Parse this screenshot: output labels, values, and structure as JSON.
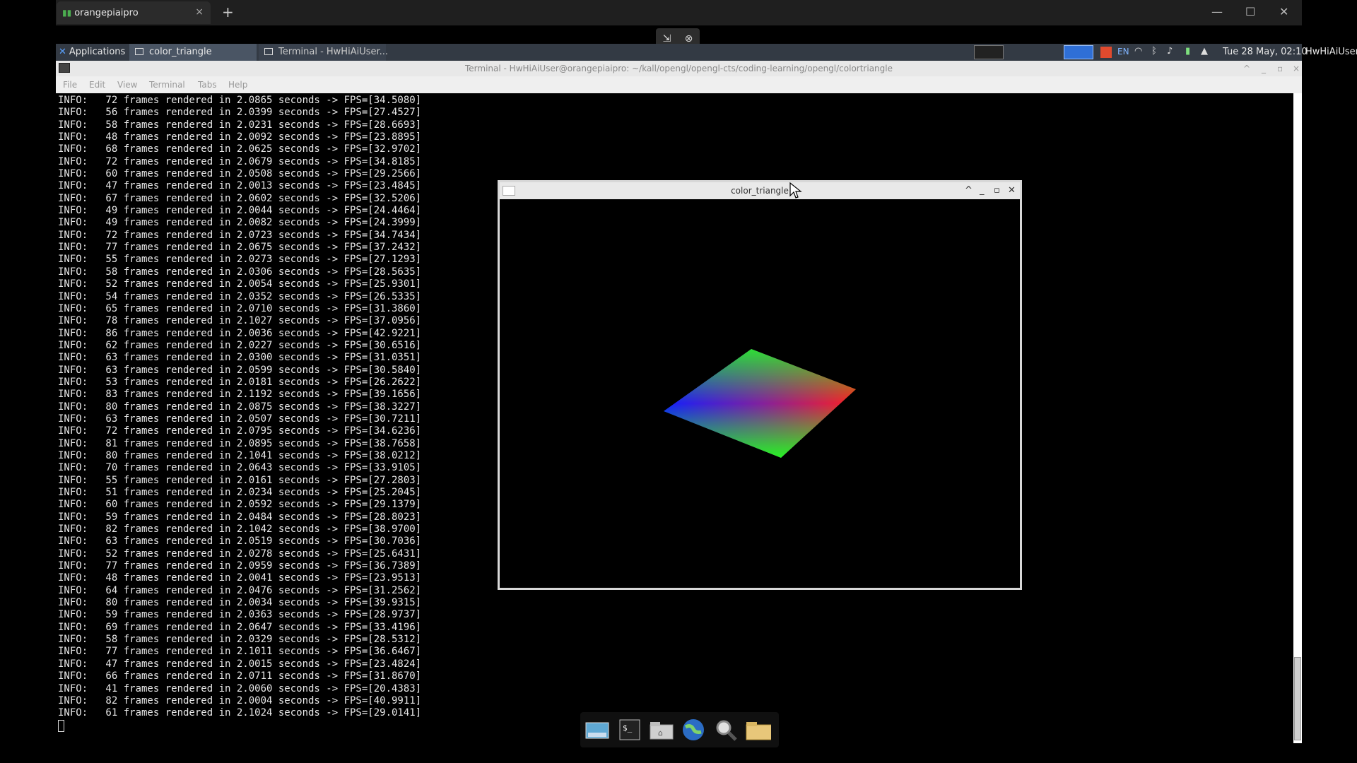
{
  "host": {
    "tab_label": "orangepiaipro",
    "tab_close": "×",
    "new_tab": "+",
    "minimize": "—",
    "maximize": "☐",
    "close": "✕"
  },
  "panel": {
    "applications": "Applications",
    "tasks": [
      {
        "label": "color_triangle"
      },
      {
        "label": "Terminal - HwHiAiUser..."
      }
    ],
    "lang": "EN",
    "clock": "Tue 28 May, 02:10",
    "user": "HwHiAiUser"
  },
  "terminal": {
    "title": "Terminal - HwHiAiUser@orangepiaipro: ~/kall/opengl/opengl-cts/coding-learning/opengl/colortriangle",
    "menu": [
      "File",
      "Edit",
      "View",
      "Terminal",
      "Tabs",
      "Help"
    ],
    "log_lines": [
      "INFO:   72 frames rendered in 2.0865 seconds -> FPS=[34.5080]",
      "INFO:   56 frames rendered in 2.0399 seconds -> FPS=[27.4527]",
      "INFO:   58 frames rendered in 2.0231 seconds -> FPS=[28.6693]",
      "INFO:   48 frames rendered in 2.0092 seconds -> FPS=[23.8895]",
      "INFO:   68 frames rendered in 2.0625 seconds -> FPS=[32.9702]",
      "INFO:   72 frames rendered in 2.0679 seconds -> FPS=[34.8185]",
      "INFO:   60 frames rendered in 2.0508 seconds -> FPS=[29.2566]",
      "INFO:   47 frames rendered in 2.0013 seconds -> FPS=[23.4845]",
      "INFO:   67 frames rendered in 2.0602 seconds -> FPS=[32.5206]",
      "INFO:   49 frames rendered in 2.0044 seconds -> FPS=[24.4464]",
      "INFO:   49 frames rendered in 2.0082 seconds -> FPS=[24.3999]",
      "INFO:   72 frames rendered in 2.0723 seconds -> FPS=[34.7434]",
      "INFO:   77 frames rendered in 2.0675 seconds -> FPS=[37.2432]",
      "INFO:   55 frames rendered in 2.0273 seconds -> FPS=[27.1293]",
      "INFO:   58 frames rendered in 2.0306 seconds -> FPS=[28.5635]",
      "INFO:   52 frames rendered in 2.0054 seconds -> FPS=[25.9301]",
      "INFO:   54 frames rendered in 2.0352 seconds -> FPS=[26.5335]",
      "INFO:   65 frames rendered in 2.0710 seconds -> FPS=[31.3860]",
      "INFO:   78 frames rendered in 2.1027 seconds -> FPS=[37.0956]",
      "INFO:   86 frames rendered in 2.0036 seconds -> FPS=[42.9221]",
      "INFO:   62 frames rendered in 2.0227 seconds -> FPS=[30.6516]",
      "INFO:   63 frames rendered in 2.0300 seconds -> FPS=[31.0351]",
      "INFO:   63 frames rendered in 2.0599 seconds -> FPS=[30.5840]",
      "INFO:   53 frames rendered in 2.0181 seconds -> FPS=[26.2622]",
      "INFO:   83 frames rendered in 2.1192 seconds -> FPS=[39.1656]",
      "INFO:   80 frames rendered in 2.0875 seconds -> FPS=[38.3227]",
      "INFO:   63 frames rendered in 2.0507 seconds -> FPS=[30.7211]",
      "INFO:   72 frames rendered in 2.0795 seconds -> FPS=[34.6236]",
      "INFO:   81 frames rendered in 2.0895 seconds -> FPS=[38.7658]",
      "INFO:   80 frames rendered in 2.1041 seconds -> FPS=[38.0212]",
      "INFO:   70 frames rendered in 2.0643 seconds -> FPS=[33.9105]",
      "INFO:   55 frames rendered in 2.0161 seconds -> FPS=[27.2803]",
      "INFO:   51 frames rendered in 2.0234 seconds -> FPS=[25.2045]",
      "INFO:   60 frames rendered in 2.0592 seconds -> FPS=[29.1379]",
      "INFO:   59 frames rendered in 2.0484 seconds -> FPS=[28.8023]",
      "INFO:   82 frames rendered in 2.1042 seconds -> FPS=[38.9700]",
      "INFO:   63 frames rendered in 2.0519 seconds -> FPS=[30.7036]",
      "INFO:   52 frames rendered in 2.0278 seconds -> FPS=[25.6431]",
      "INFO:   77 frames rendered in 2.0959 seconds -> FPS=[36.7389]",
      "INFO:   48 frames rendered in 2.0041 seconds -> FPS=[23.9513]",
      "INFO:   64 frames rendered in 2.0476 seconds -> FPS=[31.2562]",
      "INFO:   80 frames rendered in 2.0034 seconds -> FPS=[39.9315]",
      "INFO:   59 frames rendered in 2.0363 seconds -> FPS=[28.9737]",
      "INFO:   69 frames rendered in 2.0647 seconds -> FPS=[33.4196]",
      "INFO:   58 frames rendered in 2.0329 seconds -> FPS=[28.5312]",
      "INFO:   77 frames rendered in 2.1011 seconds -> FPS=[36.6467]",
      "INFO:   47 frames rendered in 2.0015 seconds -> FPS=[23.4824]",
      "INFO:   66 frames rendered in 2.0711 seconds -> FPS=[31.8670]",
      "INFO:   41 frames rendered in 2.0060 seconds -> FPS=[20.4383]",
      "INFO:   82 frames rendered in 2.0004 seconds -> FPS=[40.9911]",
      "INFO:   61 frames rendered in 2.1024 seconds -> FPS=[29.0141]"
    ]
  },
  "triangle_window": {
    "title": "color_triangle"
  },
  "dock": {
    "items": [
      "desktop-icon",
      "terminal-icon",
      "home-folder-icon",
      "web-browser-icon",
      "search-icon",
      "files-icon"
    ]
  },
  "colors": {
    "panel_bg": "#333a44",
    "terminal_bg": "#000000",
    "terminal_fg": "#e8e8e8",
    "accent_blue": "#2f6fd6"
  }
}
